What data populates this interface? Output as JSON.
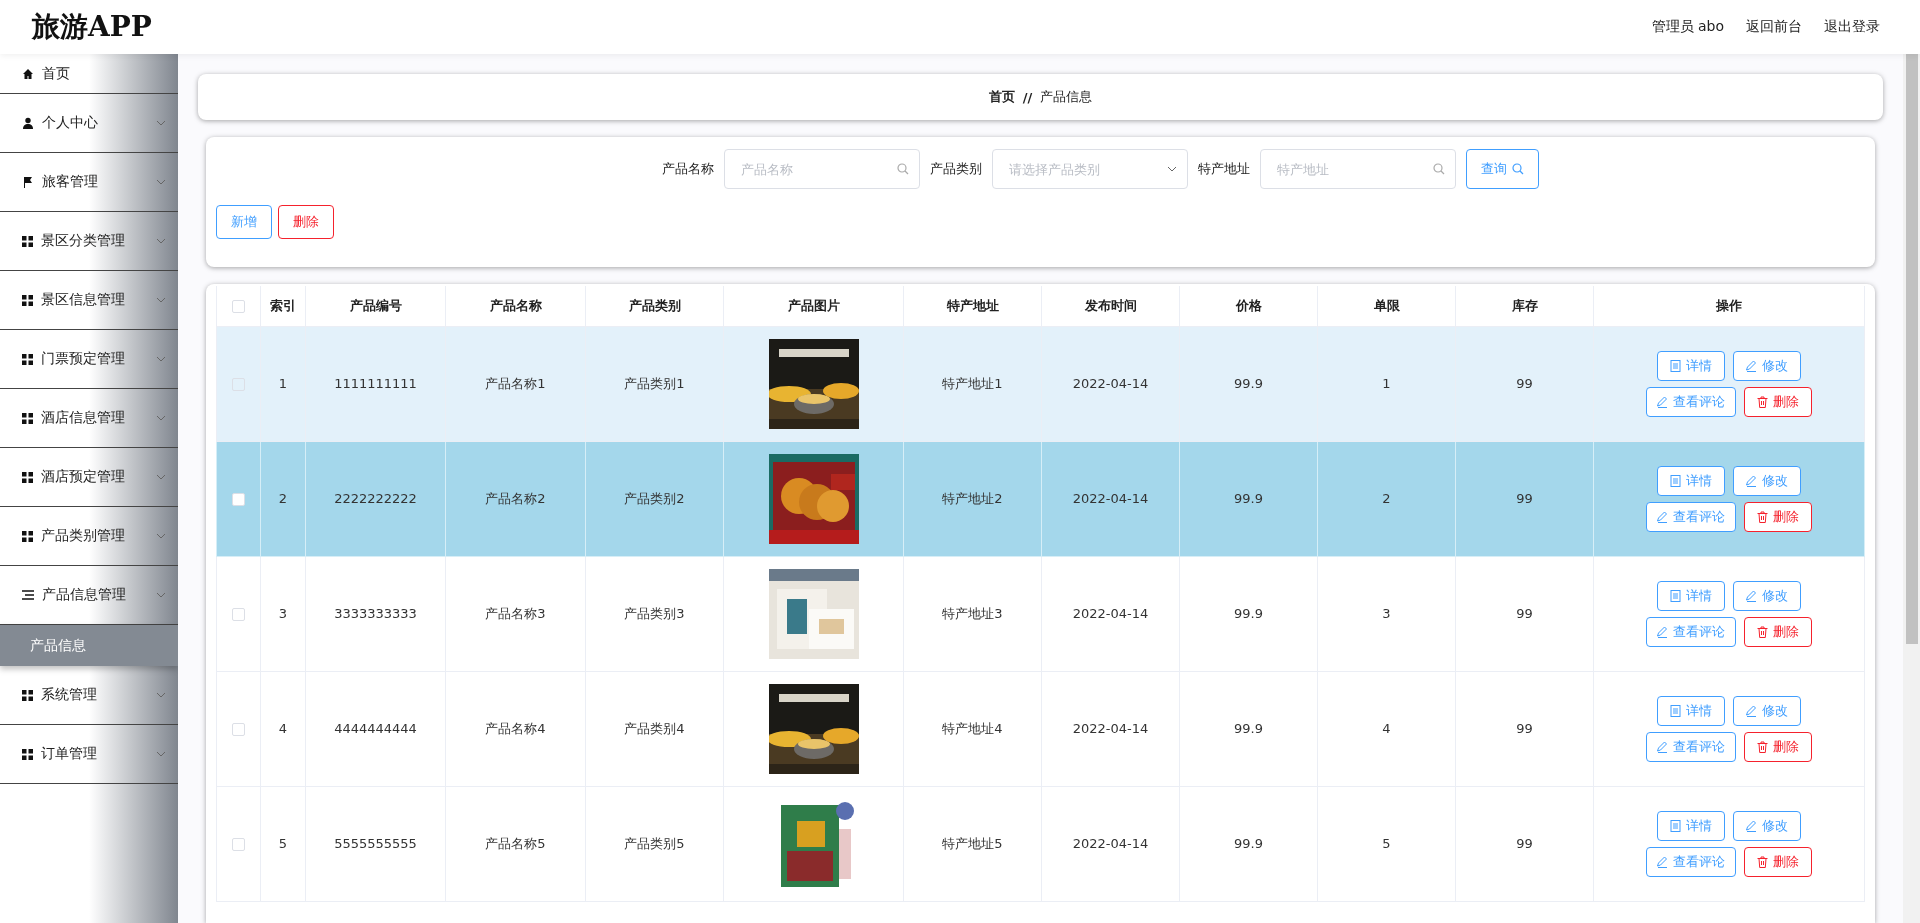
{
  "header": {
    "logo": "旅游APP",
    "links": [
      "管理员 abo",
      "返回前台",
      "退出登录"
    ]
  },
  "sidebar": {
    "items": [
      {
        "label": "首页",
        "kind": "home",
        "expandable": false
      },
      {
        "label": "个人中心",
        "kind": "user",
        "expandable": true,
        "expanded": false
      },
      {
        "label": "旅客管理",
        "kind": "flag",
        "expandable": true,
        "expanded": false
      },
      {
        "label": "景区分类管理",
        "kind": "grid",
        "expandable": true,
        "expanded": false
      },
      {
        "label": "景区信息管理",
        "kind": "grid",
        "expandable": true,
        "expanded": false
      },
      {
        "label": "门票预定管理",
        "kind": "grid",
        "expandable": true,
        "expanded": false
      },
      {
        "label": "酒店信息管理",
        "kind": "grid",
        "expandable": true,
        "expanded": false
      },
      {
        "label": "酒店预定管理",
        "kind": "grid",
        "expandable": true,
        "expanded": false
      },
      {
        "label": "产品类别管理",
        "kind": "grid",
        "expandable": true,
        "expanded": false
      },
      {
        "label": "产品信息管理",
        "kind": "list",
        "expandable": true,
        "expanded": true,
        "children": [
          {
            "label": "产品信息",
            "selected": true
          }
        ]
      },
      {
        "label": "系统管理",
        "kind": "grid",
        "expandable": true,
        "expanded": false
      },
      {
        "label": "订单管理",
        "kind": "grid",
        "expandable": true,
        "expanded": false
      }
    ]
  },
  "breadcrumb": [
    "首页",
    "//",
    "产品信息"
  ],
  "search": {
    "fields": [
      {
        "kind": "text",
        "label": "产品名称",
        "placeholder": "产品名称"
      },
      {
        "kind": "select",
        "label": "产品类别",
        "placeholder": "请选择产品类别"
      },
      {
        "kind": "text",
        "label": "特产地址",
        "placeholder": "特产地址"
      }
    ],
    "query_button": "查询",
    "add_button": "新增",
    "delete_button": "删除"
  },
  "table": {
    "header_checked": false,
    "columns": [
      "索引",
      "产品编号",
      "产品名称",
      "产品类别",
      "产品图片",
      "特产地址",
      "发布时间",
      "价格",
      "单限",
      "库存",
      "操作"
    ],
    "rows": [
      {
        "checked": false,
        "selected": false,
        "hovered": true,
        "index": "1",
        "code": "1111111111",
        "name": "产品名称1",
        "category": "产品类别1",
        "address": "特产地址1",
        "date": "2022-04-14",
        "price": "99.9",
        "limit": "1",
        "stock": "99",
        "actions": [
          "详情",
          "修改",
          "查看评论",
          "删除"
        ]
      },
      {
        "checked": false,
        "selected": true,
        "hovered": false,
        "index": "2",
        "code": "2222222222",
        "name": "产品名称2",
        "category": "产品类别2",
        "address": "特产地址2",
        "date": "2022-04-14",
        "price": "99.9",
        "limit": "2",
        "stock": "99",
        "actions": [
          "详情",
          "修改",
          "查看评论",
          "删除"
        ]
      },
      {
        "checked": false,
        "selected": false,
        "hovered": false,
        "index": "3",
        "code": "3333333333",
        "name": "产品名称3",
        "category": "产品类别3",
        "address": "特产地址3",
        "date": "2022-04-14",
        "price": "99.9",
        "limit": "3",
        "stock": "99",
        "actions": [
          "详情",
          "修改",
          "查看评论",
          "删除"
        ]
      },
      {
        "checked": false,
        "selected": false,
        "hovered": false,
        "index": "4",
        "code": "4444444444",
        "name": "产品名称4",
        "category": "产品类别4",
        "address": "特产地址4",
        "date": "2022-04-14",
        "price": "99.9",
        "limit": "4",
        "stock": "99",
        "actions": [
          "详情",
          "修改",
          "查看评论",
          "删除"
        ]
      },
      {
        "checked": false,
        "selected": false,
        "hovered": false,
        "index": "5",
        "code": "5555555555",
        "name": "产品名称5",
        "category": "产品类别5",
        "address": "特产地址5",
        "date": "2022-04-14",
        "price": "99.9",
        "limit": "5",
        "stock": "99",
        "actions": [
          "详情",
          "修改",
          "查看评论",
          "删除"
        ]
      }
    ]
  }
}
